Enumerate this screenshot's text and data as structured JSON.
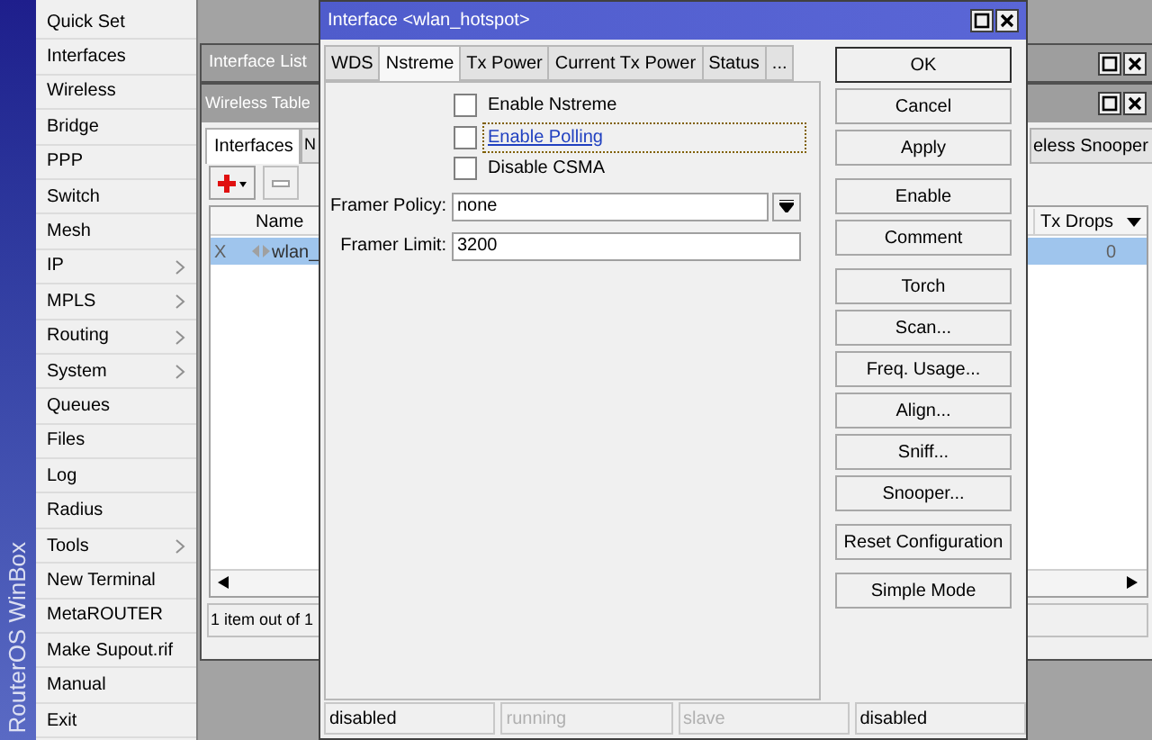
{
  "sidebar": {
    "title": "RouterOS WinBox",
    "items": [
      {
        "label": "Quick Set",
        "submenu": false
      },
      {
        "label": "Interfaces",
        "submenu": false
      },
      {
        "label": "Wireless",
        "submenu": false
      },
      {
        "label": "Bridge",
        "submenu": false
      },
      {
        "label": "PPP",
        "submenu": false
      },
      {
        "label": "Switch",
        "submenu": false
      },
      {
        "label": "Mesh",
        "submenu": false
      },
      {
        "label": "IP",
        "submenu": true
      },
      {
        "label": "MPLS",
        "submenu": true
      },
      {
        "label": "Routing",
        "submenu": true
      },
      {
        "label": "System",
        "submenu": true
      },
      {
        "label": "Queues",
        "submenu": false
      },
      {
        "label": "Files",
        "submenu": false
      },
      {
        "label": "Log",
        "submenu": false
      },
      {
        "label": "Radius",
        "submenu": false
      },
      {
        "label": "Tools",
        "submenu": true
      },
      {
        "label": "New Terminal",
        "submenu": false
      },
      {
        "label": "MetaROUTER",
        "submenu": false
      },
      {
        "label": "Make Supout.rif",
        "submenu": false
      },
      {
        "label": "Manual",
        "submenu": false
      },
      {
        "label": "Exit",
        "submenu": false
      }
    ]
  },
  "interface_list_window": {
    "title": "Interface List"
  },
  "wireless_tables_window": {
    "title": "Wireless Table",
    "tabs": [
      {
        "label": "Interfaces",
        "selected": true
      },
      {
        "label": "N",
        "selected": false
      },
      {
        "label": "eless Snooper",
        "selected": false
      }
    ],
    "columns": [
      {
        "label": "Name"
      },
      {
        "label": "Tx Drops"
      }
    ],
    "rows": [
      {
        "flag": "X",
        "name": "wlan_",
        "tx_drops": "0",
        "selected": true
      }
    ],
    "status": "1 item out of 1"
  },
  "dialog": {
    "title": "Interface <wlan_hotspot>",
    "tabs": [
      {
        "label": "WDS",
        "selected": false
      },
      {
        "label": "Nstreme",
        "selected": true
      },
      {
        "label": "Tx Power",
        "selected": false
      },
      {
        "label": "Current Tx Power",
        "selected": false
      },
      {
        "label": "Status",
        "selected": false
      },
      {
        "label": "...",
        "selected": false
      }
    ],
    "checkboxes": [
      {
        "label": "Enable Nstreme",
        "checked": false,
        "focused": false
      },
      {
        "label": "Enable Polling",
        "checked": false,
        "focused": true
      },
      {
        "label": "Disable CSMA",
        "checked": false,
        "focused": false
      }
    ],
    "fields": [
      {
        "label": "Framer Policy:",
        "value": "none",
        "kind": "dropdown"
      },
      {
        "label": "Framer Limit:",
        "value": "3200",
        "kind": "text"
      }
    ],
    "button_groups": [
      [
        {
          "label": "OK",
          "default": true
        },
        {
          "label": "Cancel",
          "default": false
        },
        {
          "label": "Apply",
          "default": false
        }
      ],
      [
        {
          "label": "Enable",
          "default": false
        },
        {
          "label": "Comment",
          "default": false
        }
      ],
      [
        {
          "label": "Torch",
          "default": false
        },
        {
          "label": "Scan...",
          "default": false
        },
        {
          "label": "Freq. Usage...",
          "default": false
        },
        {
          "label": "Align...",
          "default": false
        },
        {
          "label": "Sniff...",
          "default": false
        },
        {
          "label": "Snooper...",
          "default": false
        }
      ],
      [
        {
          "label": "Reset Configuration",
          "default": false
        }
      ],
      [
        {
          "label": "Simple Mode",
          "default": false
        }
      ]
    ],
    "status": [
      {
        "text": "disabled",
        "active": true
      },
      {
        "text": "running",
        "active": false
      },
      {
        "text": "slave",
        "active": false
      },
      {
        "text": "disabled",
        "active": true
      }
    ]
  }
}
